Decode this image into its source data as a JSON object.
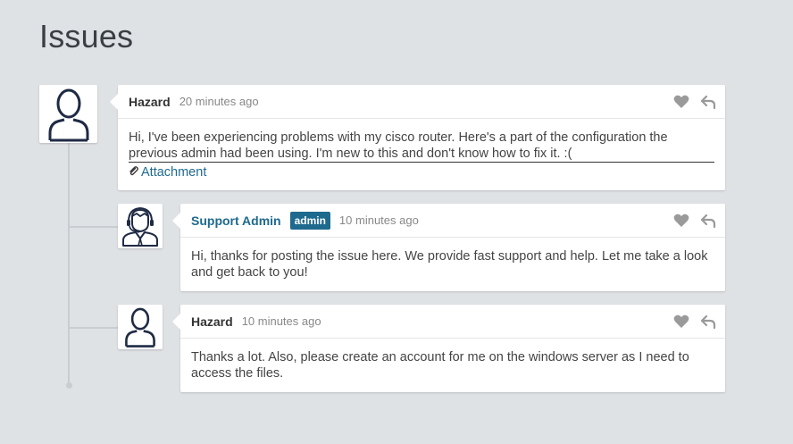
{
  "page": {
    "title": "Issues"
  },
  "comments": [
    {
      "author": "Hazard",
      "time": "20 minutes ago",
      "body": "Hi, I've been experiencing problems with my cisco router. Here's a part of the configuration the previous admin had been using. I'm new to this and don't know how to fix it. :(",
      "attachment_label": "Attachment",
      "avatar_icon": "user-outline-icon"
    },
    {
      "author": "Support Admin",
      "badge": "admin",
      "time": "10 minutes ago",
      "body": "Hi, thanks for posting the issue here. We provide fast support and help. Let me take a look and get back to you!",
      "avatar_icon": "support-agent-icon"
    },
    {
      "author": "Hazard",
      "time": "10 minutes ago",
      "body": "Thanks a lot. Also, please create an account for me on the windows server as I need to access the files.",
      "avatar_icon": "user-outline-icon"
    }
  ],
  "actions": {
    "like_icon": "heart-icon",
    "reply_icon": "reply-icon"
  },
  "colors": {
    "background": "#dfe2e5",
    "accent": "#1e6a8e",
    "icon_gray": "#9a9a9a"
  }
}
